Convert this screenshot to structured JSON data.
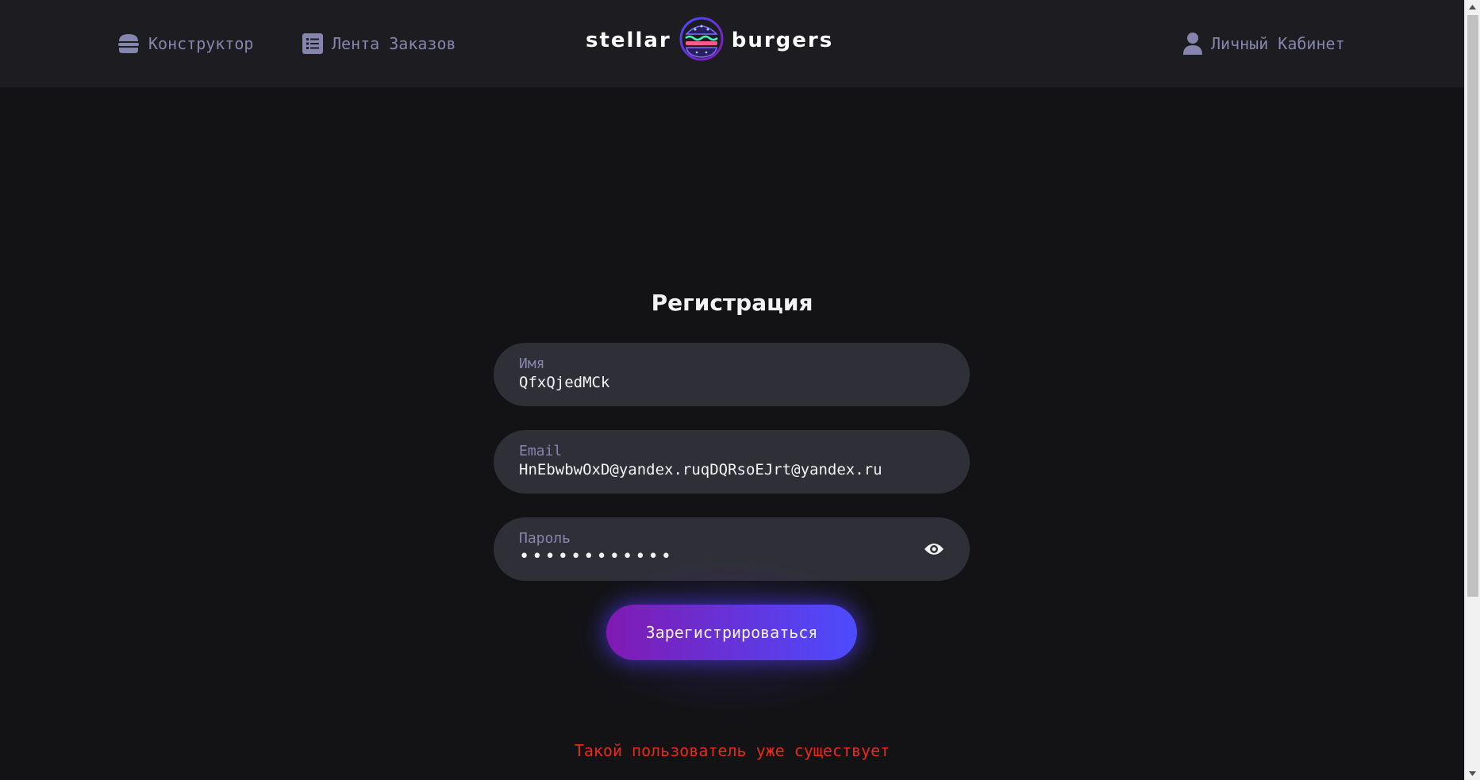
{
  "header": {
    "nav_constructor": "Конструктор",
    "nav_feed": "Лента Заказов",
    "nav_profile": "Личный Кабинет",
    "logo_left": "stellar",
    "logo_right": "burgers"
  },
  "form": {
    "title": "Регистрация",
    "name_label": "Имя",
    "name_value": "QfxQjedMCk",
    "email_label": "Email",
    "email_value": "HnEbwbwOxD@yandex.ruqDQRsoEJrt@yandex.ru",
    "password_label": "Пароль",
    "password_mask": "••••••••••••",
    "submit_label": "Зарегистрироваться",
    "error_message": "Такой пользователь уже существует"
  },
  "colors": {
    "background": "#131316",
    "header_bg": "#1c1c21",
    "field_bg": "#2f2f37",
    "muted_text": "#8585ad",
    "accent_from": "#801ab2",
    "accent_to": "#4c4cff",
    "error": "#e52b1a"
  },
  "icons": {
    "constructor": "burger-icon",
    "feed": "list-icon",
    "profile": "user-icon",
    "password_toggle": "eye-icon",
    "logo": "burger-logo-icon"
  }
}
